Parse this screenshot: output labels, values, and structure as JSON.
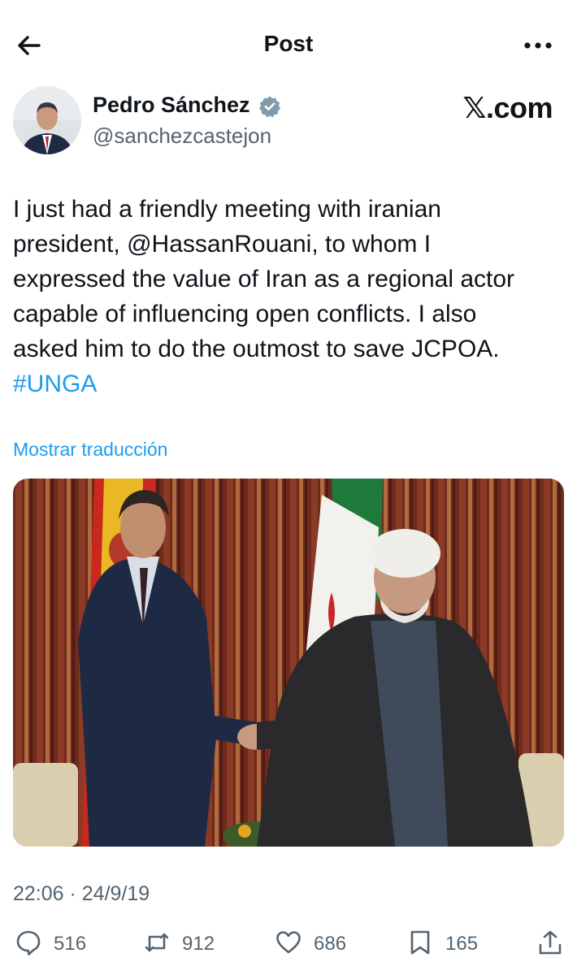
{
  "header": {
    "title": "Post"
  },
  "author": {
    "name": "Pedro Sánchez",
    "handle": "@sanchezcastejon",
    "source_mark": ".com"
  },
  "tweet": {
    "lines": [
      "I just had a friendly meeting with iranian",
      "president, @HassanRouani, to whom I",
      "expressed the value of Iran as a regional actor",
      "capable of influencing open conflicts. I also",
      "asked him to do the outmost to save JCPOA."
    ],
    "hashtag": "#UNGA",
    "translate_label": "Mostrar traducción",
    "timestamp": "22:06 · 24/9/19"
  },
  "stats": {
    "replies": "516",
    "reposts": "912",
    "likes": "686",
    "bookmarks": "165"
  },
  "colors": {
    "accent": "#1d9bf0",
    "secondary_text": "#536471",
    "verified_badge": "#829aab"
  },
  "icons": [
    "back-arrow-icon",
    "more-dots-icon",
    "verified-badge-icon",
    "reply-icon",
    "repost-icon",
    "like-icon",
    "bookmark-icon",
    "share-icon"
  ]
}
